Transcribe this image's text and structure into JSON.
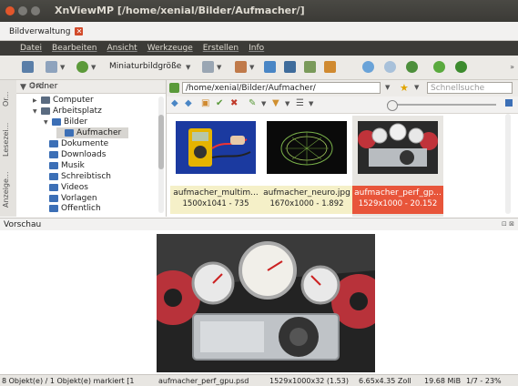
{
  "window": {
    "title": "XnViewMP [/home/xenial/Bilder/Aufmacher/]"
  },
  "tab": {
    "label": "Bildverwaltung"
  },
  "menu": [
    "Datei",
    "Bearbeiten",
    "Ansicht",
    "Werkzeuge",
    "Erstellen",
    "Info"
  ],
  "toolbar": {
    "thumb_size_label": "Miniaturbildgröße"
  },
  "sidetabs": [
    "Or...",
    "Lesezei...",
    "Anzeige..."
  ],
  "folders": {
    "title": "Ordner",
    "items": [
      {
        "label": "Computer",
        "level": 0
      },
      {
        "label": "Arbeitsplatz",
        "level": 0
      },
      {
        "label": "Bilder",
        "level": 1
      },
      {
        "label": "Aufmacher",
        "level": 2
      },
      {
        "label": "Dokumente",
        "level": 1
      },
      {
        "label": "Downloads",
        "level": 1
      },
      {
        "label": "Musik",
        "level": 1
      },
      {
        "label": "Schreibtisch",
        "level": 1
      },
      {
        "label": "Videos",
        "level": 1
      },
      {
        "label": "Vorlagen",
        "level": 1
      },
      {
        "label": "Öffentlich",
        "level": 1
      }
    ]
  },
  "address": {
    "path": "/home/xenial/Bilder/Aufmacher/",
    "search_placeholder": "Schnellsuche"
  },
  "thumbnails": [
    {
      "name": "aufmacher_multim...",
      "meta": "1500x1041 - 735"
    },
    {
      "name": "aufmacher_neuro.jpg",
      "meta": "1670x1000 - 1.892"
    },
    {
      "name": "aufmacher_perf_gp...",
      "meta": "1529x1000 - 20.152"
    }
  ],
  "preview": {
    "title": "Vorschau"
  },
  "status": {
    "selection": "8 Objekt(e) / 1 Objekt(e) markiert [1",
    "file": "aufmacher_perf_gpu.psd",
    "dims": "1529x1000x32 (1.53)",
    "size_cm": "6.65x4.35 Zoll",
    "filesize": "19.68 MiB",
    "page": "1/7 - 23%"
  }
}
